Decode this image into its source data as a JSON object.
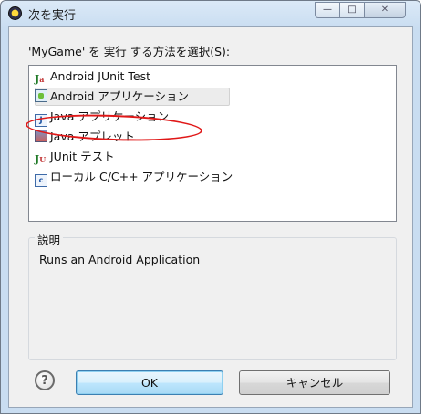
{
  "window": {
    "title": "次を実行",
    "min_label": "—",
    "max_label": "□",
    "close_label": "✕"
  },
  "prompt": "'MyGame' を 実行 する方法を選択(S):",
  "items": [
    {
      "label": "Android JUnit Test",
      "icon": "junit-android-icon"
    },
    {
      "label": "Android アプリケーション",
      "icon": "android-app-icon",
      "selected": true
    },
    {
      "label": "Java アプリケーション",
      "icon": "java-app-icon"
    },
    {
      "label": "Java アプレット",
      "icon": "java-applet-icon"
    },
    {
      "label": "JUnit テスト",
      "icon": "junit-icon"
    },
    {
      "label": "ローカル C/C++ アプリケーション",
      "icon": "cpp-app-icon"
    }
  ],
  "description": {
    "title": "説明",
    "text": "Runs an Android Application"
  },
  "buttons": {
    "help": "?",
    "ok": "OK",
    "cancel": "キャンセル"
  },
  "colors": {
    "annotation": "#e01818",
    "ok_border": "#3c7fb1"
  }
}
